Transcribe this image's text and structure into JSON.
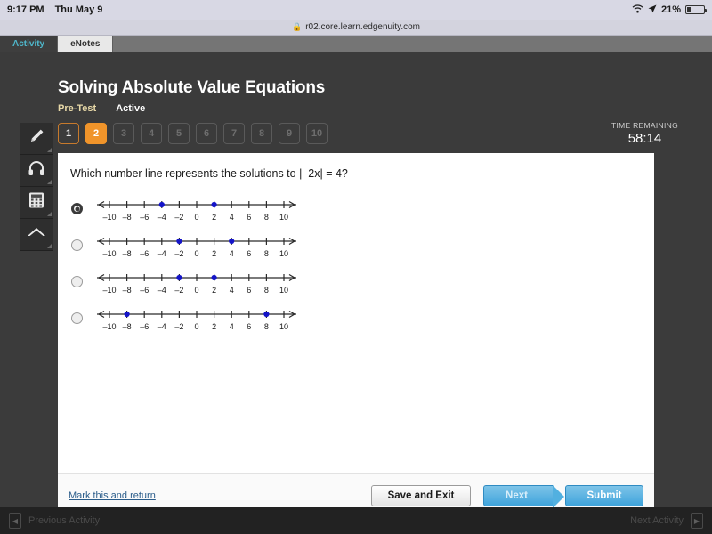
{
  "status_bar": {
    "time": "9:17 PM",
    "date": "Thu May 9",
    "wifi_icon": "wifi-icon",
    "location_icon": "location-arrow-icon",
    "battery_percent": "21%",
    "battery_icon": "battery-icon"
  },
  "url_bar": {
    "lock_icon": "lock-icon",
    "url": "r02.core.learn.edgenuity.com"
  },
  "browser_tabs": [
    {
      "label": "Activity",
      "active": true
    },
    {
      "label": "eNotes",
      "active": false
    }
  ],
  "header": {
    "course_title": "Solving Absolute Value Equations",
    "assignment_type": "Pre-Test",
    "assignment_status": "Active"
  },
  "pager": {
    "items": [
      {
        "label": "1",
        "state": "done"
      },
      {
        "label": "2",
        "state": "current"
      },
      {
        "label": "3",
        "state": "locked"
      },
      {
        "label": "4",
        "state": "locked"
      },
      {
        "label": "5",
        "state": "locked"
      },
      {
        "label": "6",
        "state": "locked"
      },
      {
        "label": "7",
        "state": "locked"
      },
      {
        "label": "8",
        "state": "locked"
      },
      {
        "label": "9",
        "state": "locked"
      },
      {
        "label": "10",
        "state": "locked"
      }
    ]
  },
  "timer": {
    "label": "TIME REMAINING",
    "value": "58:14"
  },
  "tool_rail": {
    "tools": [
      {
        "icon": "highlighter-pencil-icon",
        "name": "highlighter-tool"
      },
      {
        "icon": "headphones-icon",
        "name": "audio-tool"
      },
      {
        "icon": "calculator-icon",
        "name": "calculator-tool"
      },
      {
        "icon": "chevron-up-icon",
        "name": "collapse-tools-button"
      }
    ]
  },
  "question": {
    "prompt_prefix": "Which number line represents the solutions to ",
    "equation": "|–2x| = 4?",
    "full_text": "Which number line represents the solutions to |–2x| = 4?"
  },
  "number_line": {
    "tick_labels": [
      "–10",
      "–8",
      "–6",
      "–4",
      "–2",
      "0",
      "2",
      "4",
      "6",
      "8",
      "10"
    ],
    "tick_values": [
      -10,
      -8,
      -6,
      -4,
      -2,
      0,
      2,
      4,
      6,
      8,
      10
    ],
    "min": -11.5,
    "max": 11.5,
    "point_color": "#1414c8"
  },
  "options": [
    {
      "id": "option-a",
      "selected": true,
      "points": [
        -4,
        2
      ]
    },
    {
      "id": "option-b",
      "selected": false,
      "points": [
        -2,
        4
      ]
    },
    {
      "id": "option-c",
      "selected": false,
      "points": [
        -2,
        2
      ]
    },
    {
      "id": "option-d",
      "selected": false,
      "points": [
        -8,
        8
      ]
    }
  ],
  "footer": {
    "mark_return_label": "Mark this and return",
    "save_exit_label": "Save and Exit",
    "next_label": "Next",
    "submit_label": "Submit"
  },
  "bottom_nav": {
    "previous_label": "Previous Activity",
    "previous_icon": "triangle-left-icon",
    "next_label": "Next Activity",
    "next_icon": "triangle-right-icon"
  },
  "colors": {
    "accent_orange": "#f0942a",
    "accent_blue": "#3fa4dc",
    "tab_teal": "#4fb8cc",
    "point_blue": "#1414c8",
    "page_bg": "#3b3b3b"
  }
}
